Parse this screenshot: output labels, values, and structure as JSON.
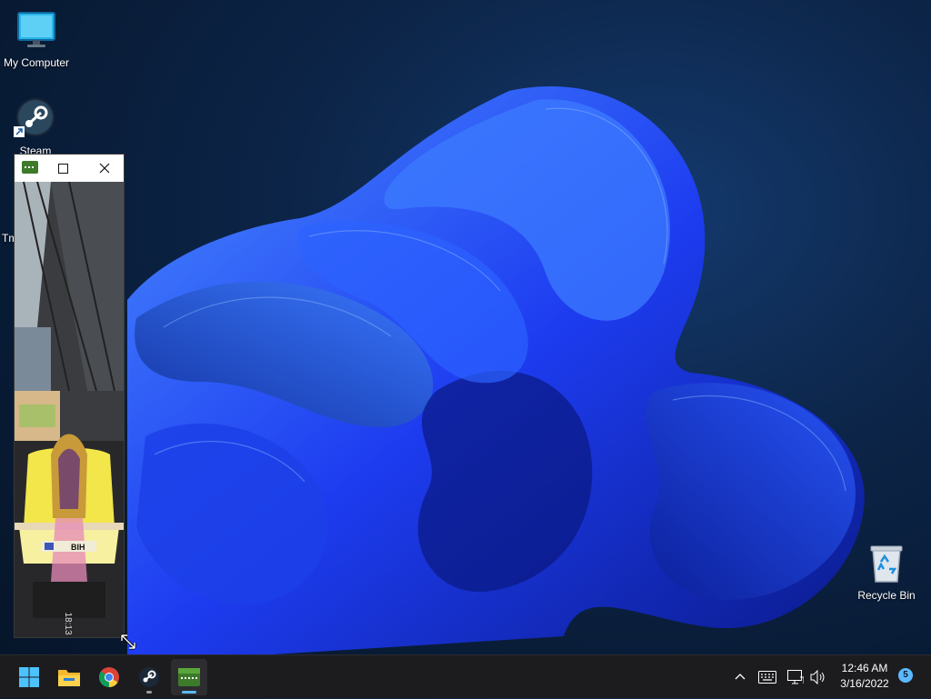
{
  "desktop": {
    "icons": {
      "my_computer": {
        "label": "My Computer",
        "icon": "monitor-icon"
      },
      "steam": {
        "label": "Steam",
        "icon": "steam-icon"
      },
      "truncated": {
        "label": "Tm"
      },
      "recycle_bin": {
        "label": "Recycle Bin",
        "icon": "recycle-bin-icon"
      }
    }
  },
  "mini_window": {
    "app_icon": "trackmania-icon",
    "maximize_icon": "maximize-icon",
    "close_icon": "close-icon",
    "game_text": {
      "plate": "BIH",
      "counter": "18:13"
    }
  },
  "taskbar": {
    "items": [
      "start-icon",
      "file-explorer-icon",
      "chrome-icon",
      "steam-icon",
      "trackmania-icon"
    ],
    "tray": {
      "chevron": "chevron-up-icon",
      "keyboard": "keyboard-icon",
      "network": "network-icon",
      "volume": "volume-icon"
    },
    "clock": {
      "time": "12:46 AM",
      "date": "3/16/2022"
    },
    "notification_count": "5"
  },
  "colors": {
    "accent": "#5cb8ff",
    "wallpaper_blue": "#1f4bff",
    "taskbar": "#1c1c1f"
  }
}
